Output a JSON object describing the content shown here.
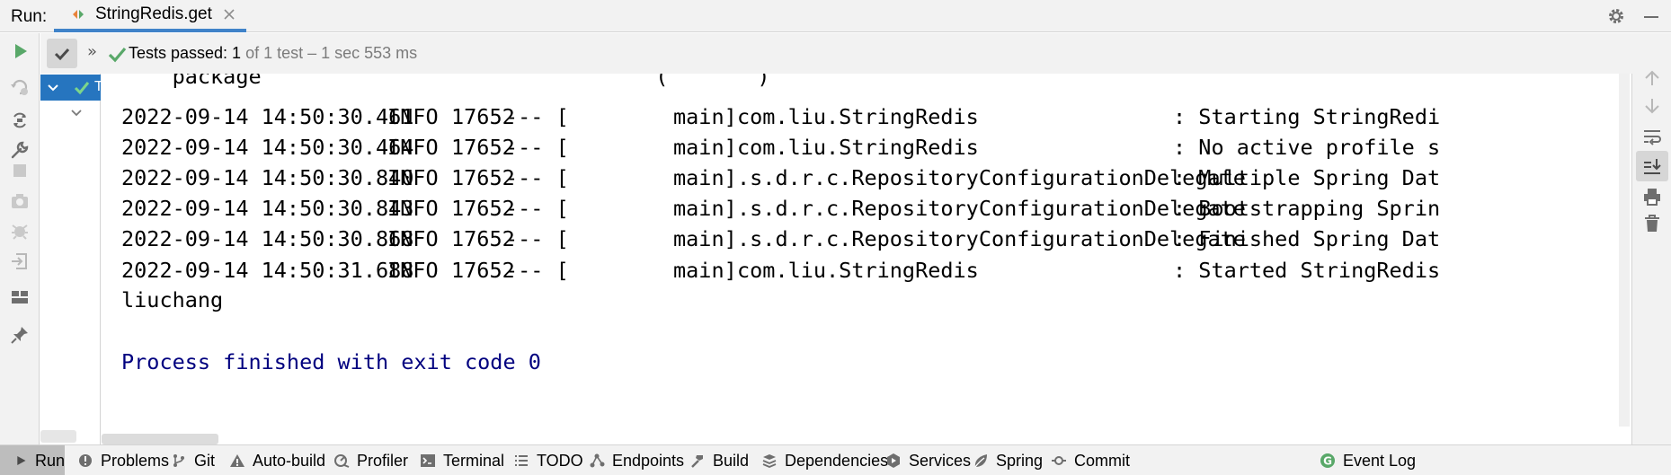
{
  "header": {
    "run_label": "Run:",
    "tab_title": "StringRedis.get",
    "icons": [
      "gear-icon",
      "minimize-icon"
    ]
  },
  "test_bar": {
    "status_strong": "Tests passed: 1",
    "status_rest": " of 1 test – 1 sec 553 ms"
  },
  "tree": {
    "selected_label": "T"
  },
  "console": {
    "clipped_top_line": "    package                               (       )",
    "log_lines": [
      {
        "timestamp": "2022-09-14 14:50:30.461",
        "level": "INFO",
        "pid": "17652",
        "sep": "--- [",
        "thread": "main]",
        "logger": "com.liu.StringRedis",
        "message": ": Starting StringRedi"
      },
      {
        "timestamp": "2022-09-14 14:50:30.464",
        "level": "INFO",
        "pid": "17652",
        "sep": "--- [",
        "thread": "main]",
        "logger": "com.liu.StringRedis",
        "message": ": No active profile s"
      },
      {
        "timestamp": "2022-09-14 14:50:30.840",
        "level": "INFO",
        "pid": "17652",
        "sep": "--- [",
        "thread": "main]",
        "logger": ".s.d.r.c.RepositoryConfigurationDelegate",
        "message": ": Multiple Spring Dat"
      },
      {
        "timestamp": "2022-09-14 14:50:30.843",
        "level": "INFO",
        "pid": "17652",
        "sep": "--- [",
        "thread": "main]",
        "logger": ".s.d.r.c.RepositoryConfigurationDelegate",
        "message": ": Bootstrapping Sprin"
      },
      {
        "timestamp": "2022-09-14 14:50:30.868",
        "level": "INFO",
        "pid": "17652",
        "sep": "--- [",
        "thread": "main]",
        "logger": ".s.d.r.c.RepositoryConfigurationDelegate",
        "message": ": Finished Spring Dat"
      },
      {
        "timestamp": "2022-09-14 14:50:31.688",
        "level": "INFO",
        "pid": "17652",
        "sep": "--- [",
        "thread": "main]",
        "logger": "com.liu.StringRedis",
        "message": ": Started StringRedis"
      }
    ],
    "output_value": "liuchang",
    "exit_message": "Process finished with exit code 0"
  },
  "bottom_bar": {
    "items": [
      {
        "label": "Run",
        "icon": "run-icon"
      },
      {
        "label": "Problems",
        "icon": "problems-icon"
      },
      {
        "label": "Git",
        "icon": "git-icon"
      },
      {
        "label": "Auto-build",
        "icon": "warning-icon"
      },
      {
        "label": "Profiler",
        "icon": "profiler-icon"
      },
      {
        "label": "Terminal",
        "icon": "terminal-icon"
      },
      {
        "label": "TODO",
        "icon": "todo-icon"
      },
      {
        "label": "Endpoints",
        "icon": "endpoints-icon"
      },
      {
        "label": "Build",
        "icon": "hammer-icon"
      },
      {
        "label": "Dependencies",
        "icon": "dependencies-icon"
      },
      {
        "label": "Services",
        "icon": "services-icon"
      },
      {
        "label": "Spring",
        "icon": "spring-icon"
      },
      {
        "label": "Commit",
        "icon": "commit-icon"
      },
      {
        "label": "Event Log",
        "icon": "event-log-icon"
      }
    ]
  },
  "colors": {
    "accent_blue": "#2675bf",
    "success_green": "#59a869",
    "exit_text": "#00007f"
  }
}
